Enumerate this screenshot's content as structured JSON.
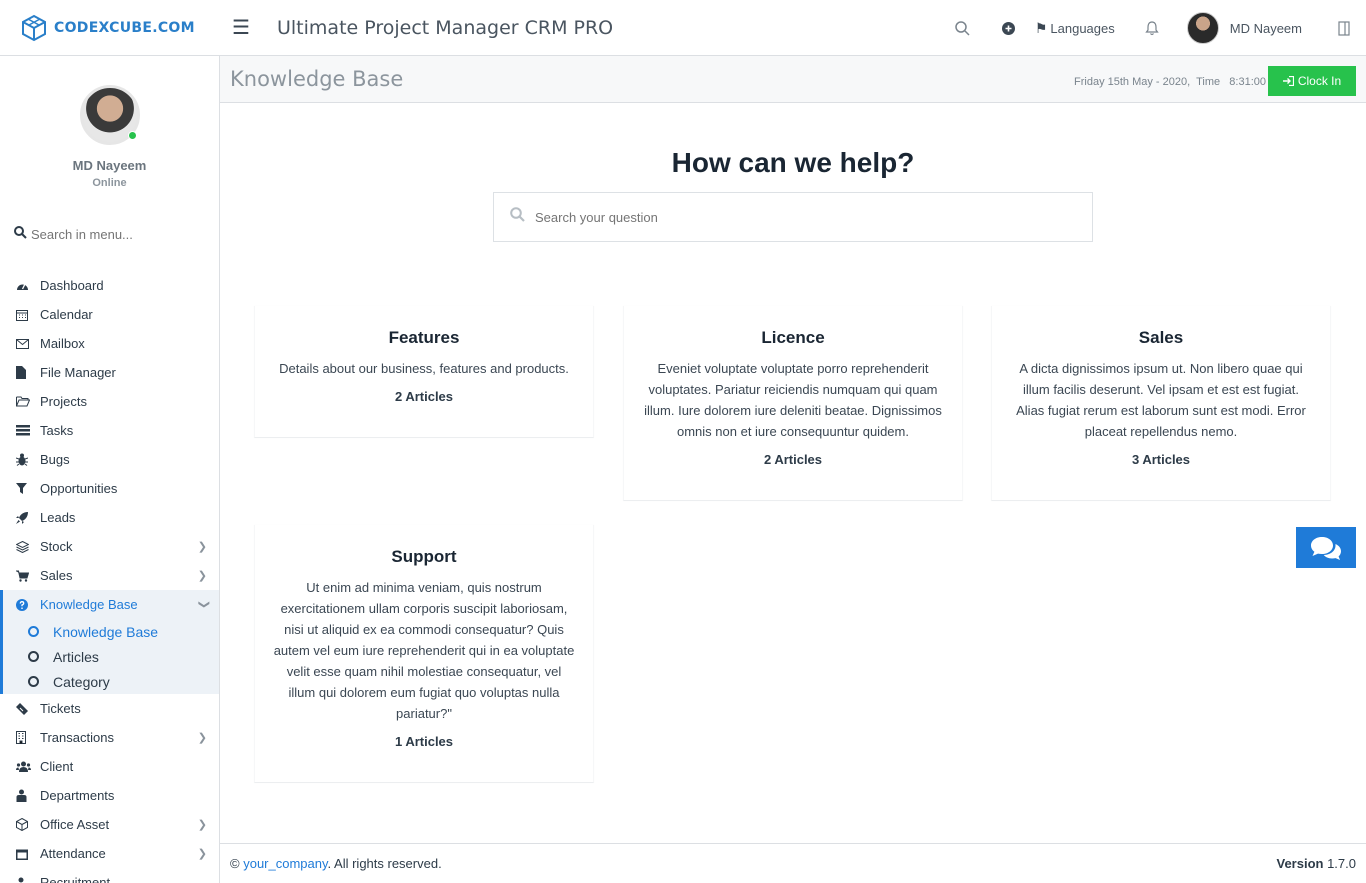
{
  "header": {
    "brand": "CODEXCUBE.COM",
    "app_title": "Ultimate Project Manager CRM PRO",
    "languages_label": "Languages",
    "user_name": "MD Nayeem"
  },
  "sidebar": {
    "profile_name": "MD Nayeem",
    "profile_status": "Online",
    "search_placeholder": "Search in menu...",
    "items": [
      {
        "label": "Dashboard",
        "icon": "dashboard-icon"
      },
      {
        "label": "Calendar",
        "icon": "calendar-icon"
      },
      {
        "label": "Mailbox",
        "icon": "mail-icon"
      },
      {
        "label": "File Manager",
        "icon": "file-icon"
      },
      {
        "label": "Projects",
        "icon": "folder-icon"
      },
      {
        "label": "Tasks",
        "icon": "tasks-icon"
      },
      {
        "label": "Bugs",
        "icon": "bug-icon"
      },
      {
        "label": "Opportunities",
        "icon": "filter-icon"
      },
      {
        "label": "Leads",
        "icon": "rocket-icon"
      },
      {
        "label": "Stock",
        "icon": "layers-icon"
      },
      {
        "label": "Sales",
        "icon": "cart-icon"
      },
      {
        "label": "Knowledge Base",
        "icon": "question-circle-icon"
      },
      {
        "label": "Tickets",
        "icon": "ticket-icon"
      },
      {
        "label": "Transactions",
        "icon": "building-icon"
      },
      {
        "label": "Client",
        "icon": "users-icon"
      },
      {
        "label": "Departments",
        "icon": "briefcase-icon"
      },
      {
        "label": "Office Asset",
        "icon": "cube-icon"
      },
      {
        "label": "Attendance",
        "icon": "calendar-check-icon"
      },
      {
        "label": "Recruitment",
        "icon": "user-plus-icon"
      }
    ],
    "kb_sub": [
      {
        "label": "Knowledge Base"
      },
      {
        "label": "Articles"
      },
      {
        "label": "Category"
      }
    ]
  },
  "pagebar": {
    "title": "Knowledge Base",
    "datetime": "Friday 15th May - 2020,  Time   8:31:00",
    "clockin_label": "Clock In"
  },
  "main": {
    "heading": "How can we help?",
    "search_placeholder": "Search your question",
    "cards": [
      {
        "title": "Features",
        "desc": "Details about our business, features and products.",
        "count": "2 Articles"
      },
      {
        "title": "Licence",
        "desc": "Eveniet voluptate voluptate porro reprehenderit voluptates. Pariatur reiciendis numquam qui quam illum. Iure dolorem iure deleniti beatae. Dignissimos omnis non et iure consequuntur quidem.",
        "count": "2 Articles"
      },
      {
        "title": "Sales",
        "desc": "A dicta dignissimos ipsum ut. Non libero quae qui illum facilis deserunt. Vel ipsam et est est fugiat. Alias fugiat rerum est laborum sunt est modi. Error placeat repellendus nemo.",
        "count": "3 Articles"
      },
      {
        "title": "Support",
        "desc": "Ut enim ad minima veniam, quis nostrum exercitationem ullam corporis suscipit laboriosam, nisi ut aliquid ex ea commodi consequatur? Quis autem vel eum iure reprehenderit qui in ea voluptate velit esse quam nihil molestiae consequatur, vel illum qui dolorem eum fugiat quo voluptas nulla pariatur?\"",
        "count": "1 Articles"
      }
    ]
  },
  "footer": {
    "copyright_symbol": "©",
    "company_link": "your_company",
    "rights": ". All rights reserved.",
    "version_label": "Version",
    "version_value": "1.7.0"
  },
  "colors": {
    "primary": "#1f7bd8",
    "success": "#27c24c",
    "brand": "#2a7fc9"
  }
}
